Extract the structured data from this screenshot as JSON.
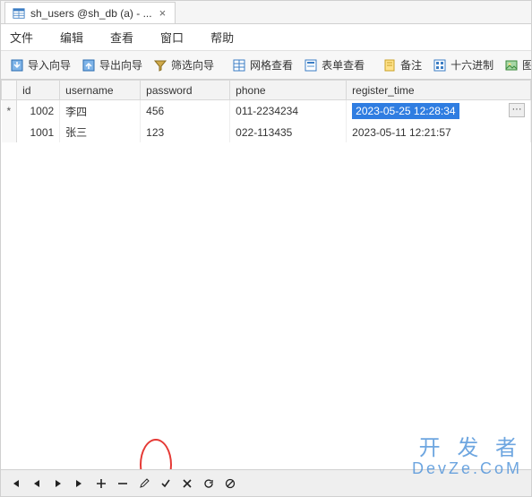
{
  "tab": {
    "title": "sh_users @sh_db (a) - ...",
    "close": "×"
  },
  "menu": {
    "file": "文件",
    "edit": "编辑",
    "view": "查看",
    "window": "窗口",
    "help": "帮助"
  },
  "toolbar": {
    "import_wizard": "导入向导",
    "export_wizard": "导出向导",
    "filter_wizard": "筛选向导",
    "grid_view": "网格查看",
    "form_view": "表单查看",
    "memo": "备注",
    "hex": "十六进制",
    "image": "图像"
  },
  "columns": {
    "marker": "",
    "id": "id",
    "username": "username",
    "password": "password",
    "phone": "phone",
    "register_time": "register_time"
  },
  "rows": [
    {
      "marker": "*",
      "id": "1002",
      "username": "李四",
      "password": "456",
      "phone": "011-2234234",
      "register_time": "2023-05-25 12:28:34",
      "selected": true
    },
    {
      "marker": "",
      "id": "1001",
      "username": "张三",
      "password": "123",
      "phone": "022-113435",
      "register_time": "2023-05-11 12:21:57",
      "selected": false
    }
  ],
  "ellipsis": "···",
  "watermark": {
    "line1": "开 发 者",
    "line2": "DevZe.CoM"
  }
}
